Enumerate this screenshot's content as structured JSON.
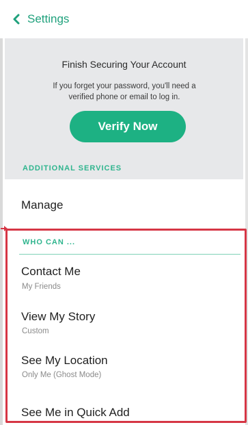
{
  "header": {
    "back_label": "Settings"
  },
  "secure": {
    "title": "Finish Securing Your Account",
    "description": "If you forget your password, you'll need a verified phone or email to log in.",
    "button_label": "Verify Now"
  },
  "sections": {
    "additional": {
      "header": "ADDITIONAL SERVICES",
      "items": [
        {
          "title": "Manage"
        }
      ]
    },
    "who_can": {
      "header": "WHO CAN ...",
      "items": [
        {
          "title": "Contact Me",
          "subtitle": "My Friends"
        },
        {
          "title": "View My Story",
          "subtitle": "Custom"
        },
        {
          "title": "See My Location",
          "subtitle": "Only Me (Ghost Mode)"
        },
        {
          "title": "See Me in Quick Add"
        }
      ]
    }
  },
  "colors": {
    "accent": "#1db183",
    "highlight": "#d63645",
    "background_gray": "#e7e8ea"
  },
  "icons": {
    "back": "chevron-left-icon",
    "pointer": "arrow-right-icon"
  }
}
